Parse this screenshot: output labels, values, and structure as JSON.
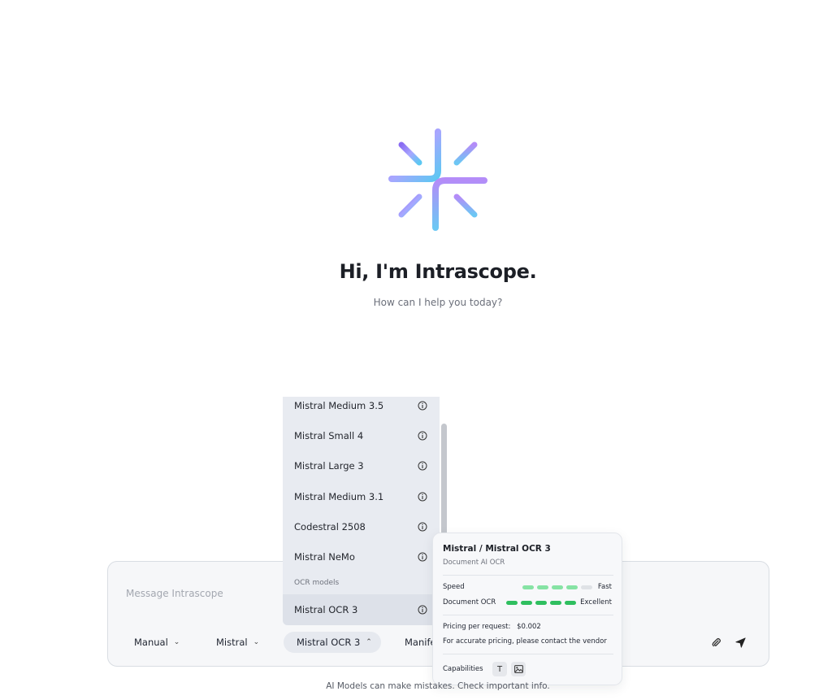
{
  "hero": {
    "title": "Hi, I'm Intrascope.",
    "subtitle": "How can I help you today?"
  },
  "composer": {
    "placeholder": "Message Intrascope",
    "mode_selector": "Manual",
    "vendor_selector": "Mistral",
    "model_selector": "Mistral OCR 3",
    "extra_selector_truncated": "Manife",
    "icons": {
      "attach": "paperclip-icon",
      "send": "send-arrow-icon",
      "chevron": "chevron-down-icon",
      "chevron_open": "chevron-up-icon"
    }
  },
  "model_dropdown": {
    "items": [
      {
        "label": "Mistral Medium 3.5",
        "icon": "info-icon"
      },
      {
        "label": "Mistral Small 4",
        "icon": "info-icon"
      },
      {
        "label": "Mistral Large 3",
        "icon": "info-icon"
      },
      {
        "label": "Mistral Medium 3.1",
        "icon": "info-icon"
      },
      {
        "label": "Codestral 2508",
        "icon": "info-icon"
      },
      {
        "label": "Mistral NeMo",
        "icon": "info-icon"
      }
    ],
    "section_label": "OCR models",
    "ocr_items": [
      {
        "label": "Mistral OCR 3",
        "icon": "info-icon",
        "selected": true
      }
    ]
  },
  "model_card": {
    "title": "Mistral / Mistral OCR 3",
    "subtitle": "Document AI OCR",
    "speed": {
      "label": "Speed",
      "value": "Fast",
      "level": 4,
      "max": 5,
      "color": "#86e3a4"
    },
    "document_ocr": {
      "label": "Document OCR",
      "value": "Excellent",
      "level": 5,
      "max": 5,
      "color": "#2fbf5f"
    },
    "pricing_label": "Pricing per request:",
    "pricing_value": "$0.002",
    "pricing_note": "For accurate pricing, please contact the vendor",
    "capabilities_label": "Capabilities",
    "capabilities": [
      "text-icon",
      "image-icon"
    ]
  },
  "footer": {
    "note": "AI Models can make mistakes. Check important info."
  },
  "colors": {
    "accent_gradient_start": "#7b6cf0",
    "accent_gradient_end": "#5ec8f0",
    "bar_empty": "#dfe2e6"
  }
}
